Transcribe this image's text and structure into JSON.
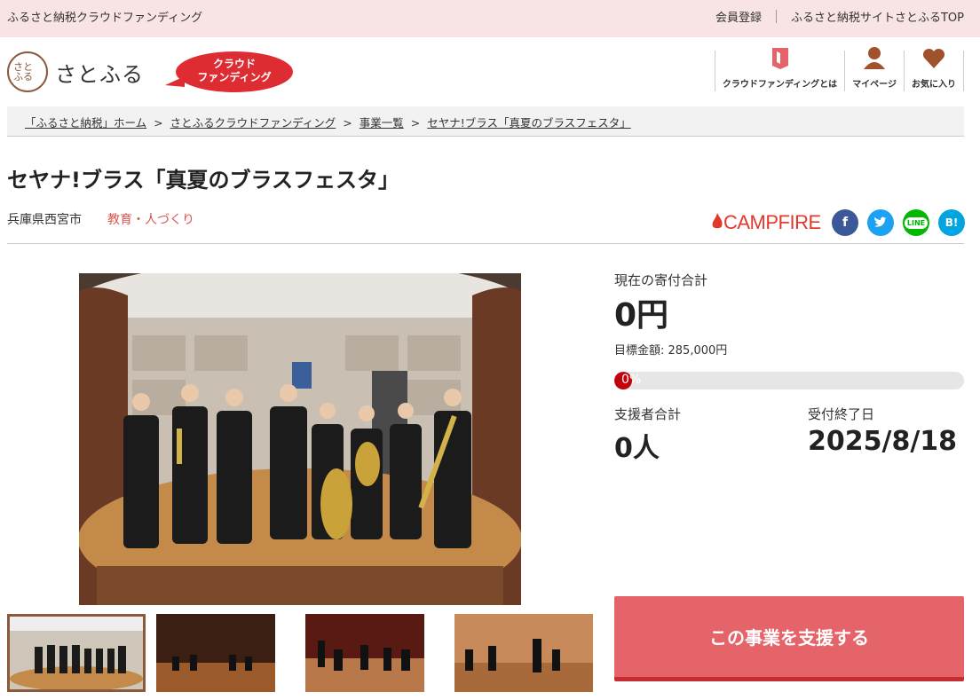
{
  "topbar": {
    "tagline": "ふるさと納税クラウドファンディング",
    "member_register": "会員登録",
    "site_top": "ふるさと納税サイトさとふるTOP"
  },
  "header": {
    "logo_mark": "さとふる",
    "logo_text": "さとふる",
    "badge_line1": "クラウド",
    "badge_line2": "ファンディング",
    "nav": [
      {
        "label": "クラウドファンディングとは",
        "icon": "book-icon"
      },
      {
        "label": "マイページ",
        "icon": "person-icon"
      },
      {
        "label": "お気に入り",
        "icon": "heart-icon"
      }
    ]
  },
  "breadcrumb": [
    "「ふるさと納税」ホーム",
    "さとふるクラウドファンディング",
    "事業一覧",
    "セヤナ!ブラス「真夏のブラスフェスタ」"
  ],
  "project": {
    "title": "セヤナ!ブラス「真夏のブラスフェスタ」",
    "location": "兵庫県西宮市",
    "category": "教育・人づくり",
    "partner": "CAMPFIRE"
  },
  "social": [
    {
      "name": "facebook",
      "glyph": "f",
      "color": "#3b5998"
    },
    {
      "name": "twitter",
      "glyph": "t",
      "color": "#1da1f2"
    },
    {
      "name": "line",
      "glyph": "LINE",
      "color": "#00b900"
    },
    {
      "name": "hatena",
      "glyph": "B!",
      "color": "#00a4de"
    }
  ],
  "stats": {
    "current_label": "現在の寄付合計",
    "current_value": "0円",
    "target_label": "目標金額: 285,000円",
    "progress_text": "0%",
    "progress_fraction": 0,
    "supporters_label": "支援者合計",
    "supporters_value": "0人",
    "deadline_label": "受付終了日",
    "deadline_value": "2025/8/18"
  },
  "cta": {
    "support_label": "この事業を支援する"
  },
  "colors": {
    "accent": "#e5646a",
    "brand_brown": "#8a5a3b",
    "progress_red": "#c4000b",
    "topbar_bg": "#f9e4e5"
  }
}
